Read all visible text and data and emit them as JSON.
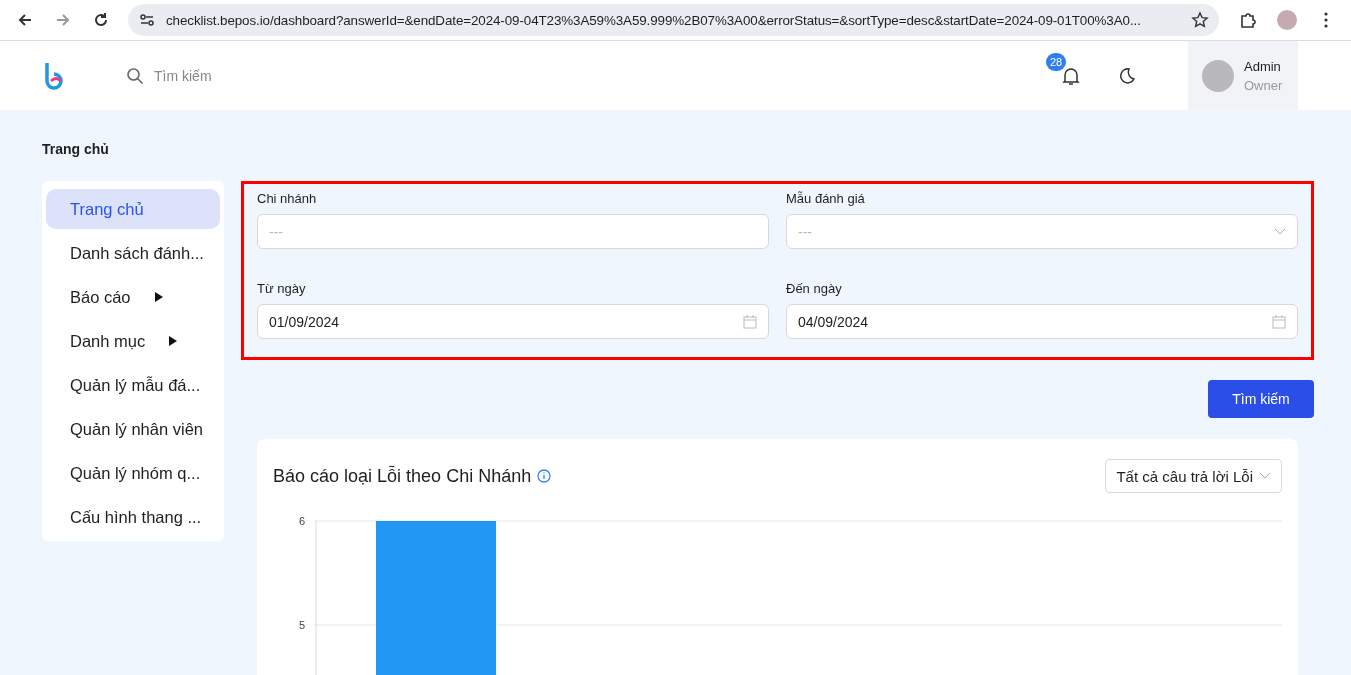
{
  "browser": {
    "url": "checklist.bepos.io/dashboard?answerId=&endDate=2024-09-04T23%3A59%3A59.999%2B07%3A00&errorStatus=&sortType=desc&startDate=2024-09-01T00%3A0..."
  },
  "header": {
    "search_placeholder": "Tìm kiếm",
    "notification_count": "28",
    "user_name": "Admin",
    "user_role": "Owner"
  },
  "breadcrumb": "Trang chủ",
  "sidebar": {
    "items": [
      {
        "label": "Trang chủ",
        "selected": true,
        "has_submenu": false
      },
      {
        "label": "Danh sách đánh...",
        "selected": false,
        "has_submenu": false
      },
      {
        "label": "Báo cáo",
        "selected": false,
        "has_submenu": true
      },
      {
        "label": "Danh mục",
        "selected": false,
        "has_submenu": true
      },
      {
        "label": "Quản lý mẫu đá...",
        "selected": false,
        "has_submenu": false
      },
      {
        "label": "Quản lý nhân viên",
        "selected": false,
        "has_submenu": false
      },
      {
        "label": "Quản lý nhóm q...",
        "selected": false,
        "has_submenu": false
      },
      {
        "label": "Cấu hình thang ...",
        "selected": false,
        "has_submenu": false
      }
    ]
  },
  "filters": [
    {
      "label": "Chi nhánh",
      "kind": "text",
      "placeholder": "---"
    },
    {
      "label": "Mẫu đánh giá",
      "kind": "select",
      "placeholder": "---"
    },
    {
      "label": "Từ ngày",
      "kind": "date",
      "value": "01/09/2024"
    },
    {
      "label": "Đến ngày",
      "kind": "date",
      "value": "04/09/2024"
    }
  ],
  "search_button": "Tìm kiếm",
  "chart_card": {
    "title": "Báo cáo loại Lỗi theo Chi Nhánh",
    "filter": "Tất cả câu trả lời Lỗi",
    "chart_data": {
      "type": "bar",
      "ylim": [
        0,
        6
      ],
      "yticks": [
        5,
        6
      ],
      "series": [
        {
          "color": "#2196f3",
          "values": [
            6
          ]
        }
      ]
    }
  }
}
